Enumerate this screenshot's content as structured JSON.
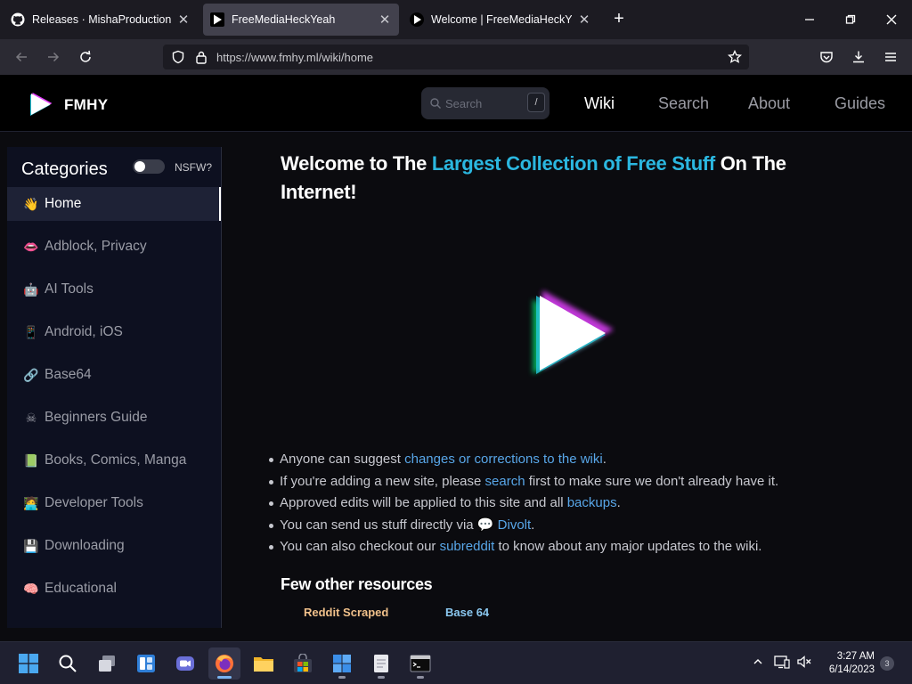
{
  "browser": {
    "tabs": [
      {
        "title": "Releases · MishaProductions/Re",
        "icon": "github-icon",
        "active": false
      },
      {
        "title": "FreeMediaHeckYeah",
        "icon": "fmhy-play-icon",
        "active": true
      },
      {
        "title": "Welcome | FreeMediaHeckYeah",
        "icon": "fmhy-play-icon",
        "active": false
      }
    ],
    "url": "https://www.fmhy.ml/wiki/home"
  },
  "site": {
    "brand": "FMHY",
    "search_placeholder": "Search",
    "search_shortcut": "/",
    "nav": [
      "Wiki",
      "Search",
      "About",
      "Guides"
    ],
    "active_nav": "Wiki"
  },
  "sidebar": {
    "title": "Categories",
    "nsfw_label": "NSFW?",
    "nsfw_enabled": false,
    "items": [
      {
        "emoji": "👋",
        "label": "Home",
        "active": true
      },
      {
        "emoji": "👄",
        "label": "Adblock, Privacy"
      },
      {
        "emoji": "🤖",
        "label": "AI Tools"
      },
      {
        "emoji": "📱",
        "label": "Android, iOS"
      },
      {
        "emoji": "🔗",
        "label": "Base64"
      },
      {
        "emoji": "☠",
        "label": "Beginners Guide"
      },
      {
        "emoji": "📗",
        "label": "Books, Comics, Manga"
      },
      {
        "emoji": "🧑‍💻",
        "label": "Developer Tools"
      },
      {
        "emoji": "💾",
        "label": "Downloading"
      },
      {
        "emoji": "🧠",
        "label": "Educational"
      }
    ]
  },
  "main": {
    "title_pre": "Welcome to The ",
    "title_highlight": "Largest Collection of Free Stuff",
    "title_post": " On The Internet!",
    "bullets": [
      {
        "pre": "Anyone can suggest ",
        "link": "changes or corrections to the wiki",
        "post": "."
      },
      {
        "pre": "If you're adding a new site, please ",
        "link": "search",
        "post": " first to make sure we don't already have it."
      },
      {
        "pre": "Approved edits will be applied to this site and all ",
        "link": "backups",
        "post": "."
      },
      {
        "pre": "You can send us stuff directly via ",
        "link": "💬 Divolt",
        "post": "."
      },
      {
        "pre": "You can also checkout our ",
        "link": "subreddit",
        "post": " to know about any major updates to the wiki."
      }
    ],
    "resources_heading": "Few other resources",
    "resources": [
      "Reddit Scraped",
      "Base 64"
    ]
  },
  "taskbar": {
    "time": "3:27 AM",
    "date": "6/14/2023",
    "notification_count": "3"
  },
  "colors": {
    "accent": "#2bb7e0",
    "link": "#58a6e8",
    "background": "#0b0b0f"
  }
}
